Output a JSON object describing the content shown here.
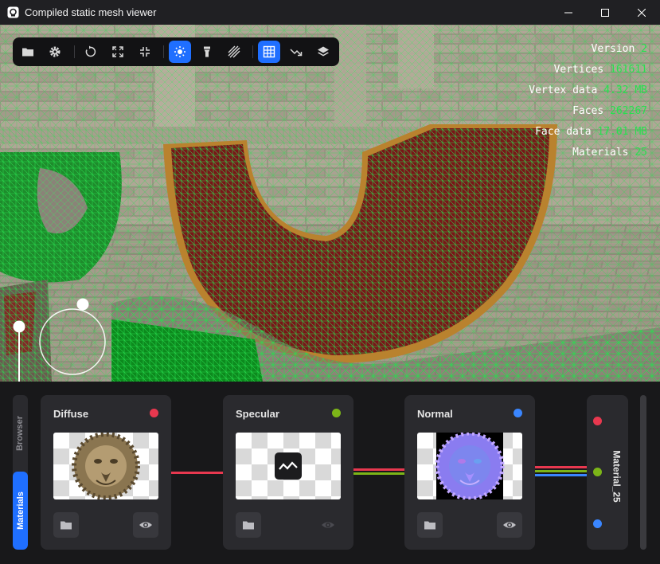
{
  "window": {
    "title": "Compiled static mesh viewer",
    "icons": {
      "app": "app-icon",
      "minimize": "minimize-icon",
      "maximize": "maximize-icon",
      "close": "close-icon"
    }
  },
  "toolbar": {
    "buttons": [
      {
        "icon": "folder-icon",
        "active": false
      },
      {
        "icon": "gear-icon",
        "active": false
      },
      {
        "icon": "reset-rotation-icon",
        "active": false
      },
      {
        "icon": "expand-icon",
        "active": false
      },
      {
        "icon": "collapse-icon",
        "active": false
      },
      {
        "icon": "sun-light-icon",
        "active": true
      },
      {
        "icon": "flashlight-icon",
        "active": false
      },
      {
        "icon": "hatch-shading-icon",
        "active": false
      },
      {
        "icon": "wireframe-grid-icon",
        "active": true
      },
      {
        "icon": "normals-arrow-icon",
        "active": false
      },
      {
        "icon": "layers-icon",
        "active": false
      }
    ]
  },
  "stats": [
    {
      "label": "Version",
      "value": "2"
    },
    {
      "label": "Vertices",
      "value": "161611"
    },
    {
      "label": "Vertex data",
      "value": "4.32 MB"
    },
    {
      "label": "Faces",
      "value": "262267"
    },
    {
      "label": "Face data",
      "value": "17.01 MB"
    },
    {
      "label": "Materials",
      "value": "25"
    }
  ],
  "side_tabs": [
    {
      "label": "Browser",
      "active": false
    },
    {
      "label": "Materials",
      "active": true
    }
  ],
  "nodes": [
    {
      "title": "Diffuse",
      "dot_color": "#e8384f",
      "thumb": "lion-diffuse-texture",
      "view_enabled": true
    },
    {
      "title": "Specular",
      "dot_color": "#7cb518",
      "thumb": "missing-texture-icon",
      "view_enabled": false
    },
    {
      "title": "Normal",
      "dot_color": "#3a86ff",
      "thumb": "lion-normal-map-texture",
      "view_enabled": true
    }
  ],
  "material": {
    "name": "Material_25"
  },
  "colors": {
    "accent": "#1f6fff",
    "wireframe": "#27e04f",
    "diffuse": "#e8384f",
    "specular": "#7cb518",
    "normal": "#3a86ff",
    "panel": "#2a2a2e",
    "background": "#18181a"
  }
}
